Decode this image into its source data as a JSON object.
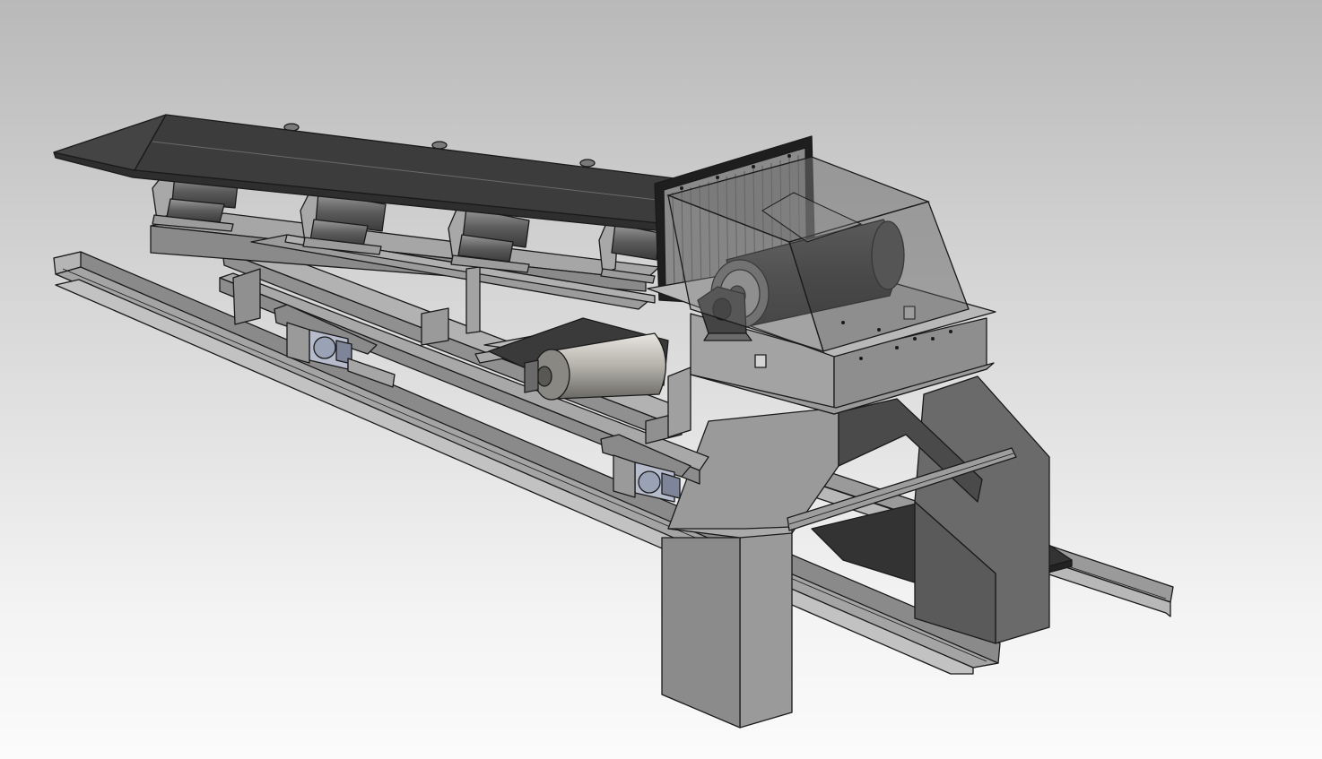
{
  "viewport": {
    "kind": "cad-3d-viewport",
    "background_top": "#b9b9b9",
    "background_bottom": "#fbfbfb"
  },
  "model": {
    "subject": "belt-conveyor-assembly",
    "parts": [
      "conveyor-belt",
      "troughing-idlers",
      "conveyor-frame",
      "ground-rails",
      "head-pulley",
      "tail-drum-pulley",
      "transparent-hood",
      "pillow-block-bearing",
      "drive-gearbox",
      "support-leg-structure",
      "discharge-plate"
    ],
    "colors": {
      "belt": "#3a3a3a",
      "steel": "#a6a6a6",
      "steel_dark": "#6e6e6e",
      "hood_glass": "#6f6f6f",
      "drive_unit": "#b6bccb"
    }
  }
}
